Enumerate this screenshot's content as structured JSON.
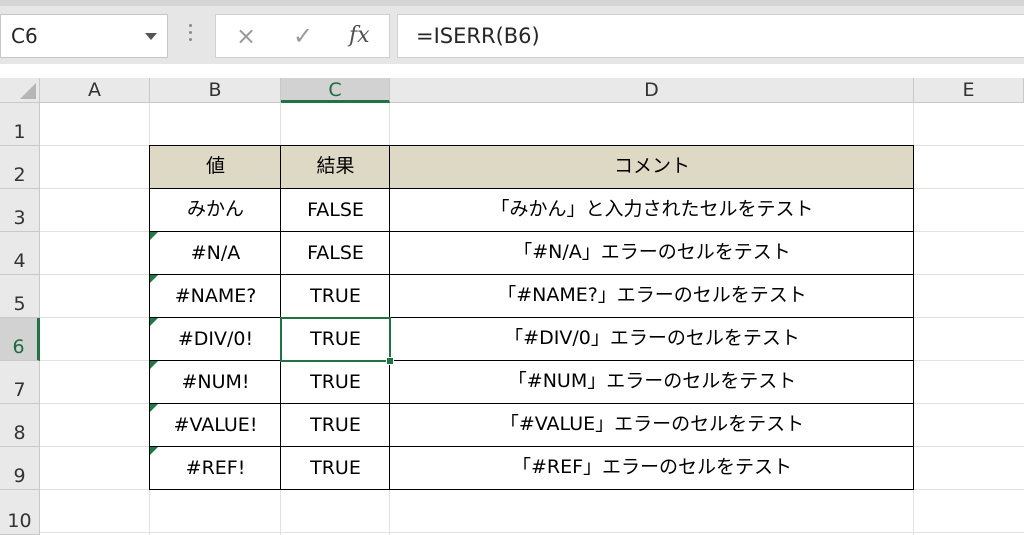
{
  "name_box": {
    "value": "C6"
  },
  "formula_bar": {
    "cancel_icon": "×",
    "enter_icon": "✓",
    "fx_label": "fx",
    "formula": "=ISERR(B6)"
  },
  "columns": [
    "A",
    "B",
    "C",
    "D",
    "E"
  ],
  "rows": [
    "1",
    "2",
    "3",
    "4",
    "5",
    "6",
    "7",
    "8",
    "9",
    "10"
  ],
  "selected_cell": "C6",
  "table": {
    "header": {
      "value": "値",
      "result": "結果",
      "comment": "コメント"
    },
    "header_fill": "#ddd9c4",
    "rows": [
      {
        "value": "みかん",
        "result": "FALSE",
        "comment": "「みかん」と入力されたセルをテスト"
      },
      {
        "value": "#N/A",
        "result": "FALSE",
        "comment": "「#N/A」エラーのセルをテスト"
      },
      {
        "value": "#NAME?",
        "result": "TRUE",
        "comment": "「#NAME?」エラーのセルをテスト"
      },
      {
        "value": "#DIV/0!",
        "result": "TRUE",
        "comment": "「#DIV/0」エラーのセルをテスト"
      },
      {
        "value": "#NUM!",
        "result": "TRUE",
        "comment": "「#NUM」エラーのセルをテスト"
      },
      {
        "value": "#VALUE!",
        "result": "TRUE",
        "comment": "「#VALUE」エラーのセルをテスト"
      },
      {
        "value": "#REF!",
        "result": "TRUE",
        "comment": "「#REF」エラーのセルをテスト"
      }
    ]
  },
  "colors": {
    "accent": "#217346"
  }
}
